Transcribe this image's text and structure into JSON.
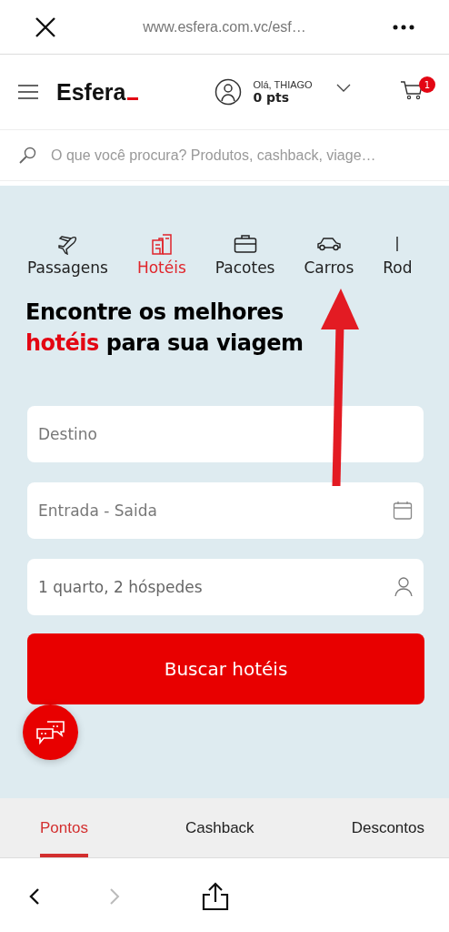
{
  "browser_bar": {
    "url": "www.esfera.com.vc/esf…"
  },
  "header": {
    "logo": "Esfera",
    "greeting": "Olá, THIAGO",
    "points": "0 pts",
    "cart_count": "1"
  },
  "search": {
    "placeholder": "O que você procura? Produtos, cashback, viage…"
  },
  "category_tabs": [
    {
      "label": "Passagens",
      "selected": false
    },
    {
      "label": "Hotéis",
      "selected": true
    },
    {
      "label": "Pacotes",
      "selected": false
    },
    {
      "label": "Carros",
      "selected": false
    },
    {
      "label": "Rod",
      "selected": false
    }
  ],
  "headline": {
    "before": "Encontre os melhores",
    "highlight": "hotéis",
    "after": "para sua viagem"
  },
  "form_fields": [
    {
      "placeholder": "Destino"
    },
    {
      "placeholder": "Entrada - Saida"
    },
    {
      "value": "1 quarto, 2 hóspedes"
    }
  ],
  "search_button": "Buscar hotéis",
  "bottom_tabs": [
    {
      "label": "Pontos",
      "selected": true
    },
    {
      "label": "Cashback",
      "selected": false
    },
    {
      "label": "Descontos",
      "selected": false
    }
  ],
  "browser_nav": {
    "back_disabled": false,
    "forward_disabled": true
  }
}
